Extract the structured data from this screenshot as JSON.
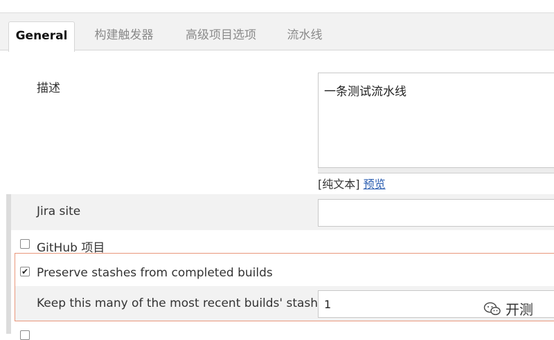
{
  "tabs": [
    {
      "label": "General",
      "active": true
    },
    {
      "label": "构建触发器"
    },
    {
      "label": "高级项目选项"
    },
    {
      "label": "流水线"
    }
  ],
  "description": {
    "label": "描述",
    "value": "一条测试流水线",
    "plain_text_label": "[纯文本]",
    "preview_link": "预览"
  },
  "jira": {
    "label": "Jira site",
    "value": ""
  },
  "github_project": {
    "label": "GitHub 项目",
    "checked": false
  },
  "preserve_stashes": {
    "label": "Preserve stashes from completed builds",
    "checked": true,
    "keep_label": "Keep this many of the most recent builds' stashes",
    "keep_value": "1"
  },
  "watermark": {
    "text": "开测",
    "icon": "wechat-icon"
  },
  "colors": {
    "highlight_border": "#e9967a",
    "link": "#2a5db0"
  }
}
